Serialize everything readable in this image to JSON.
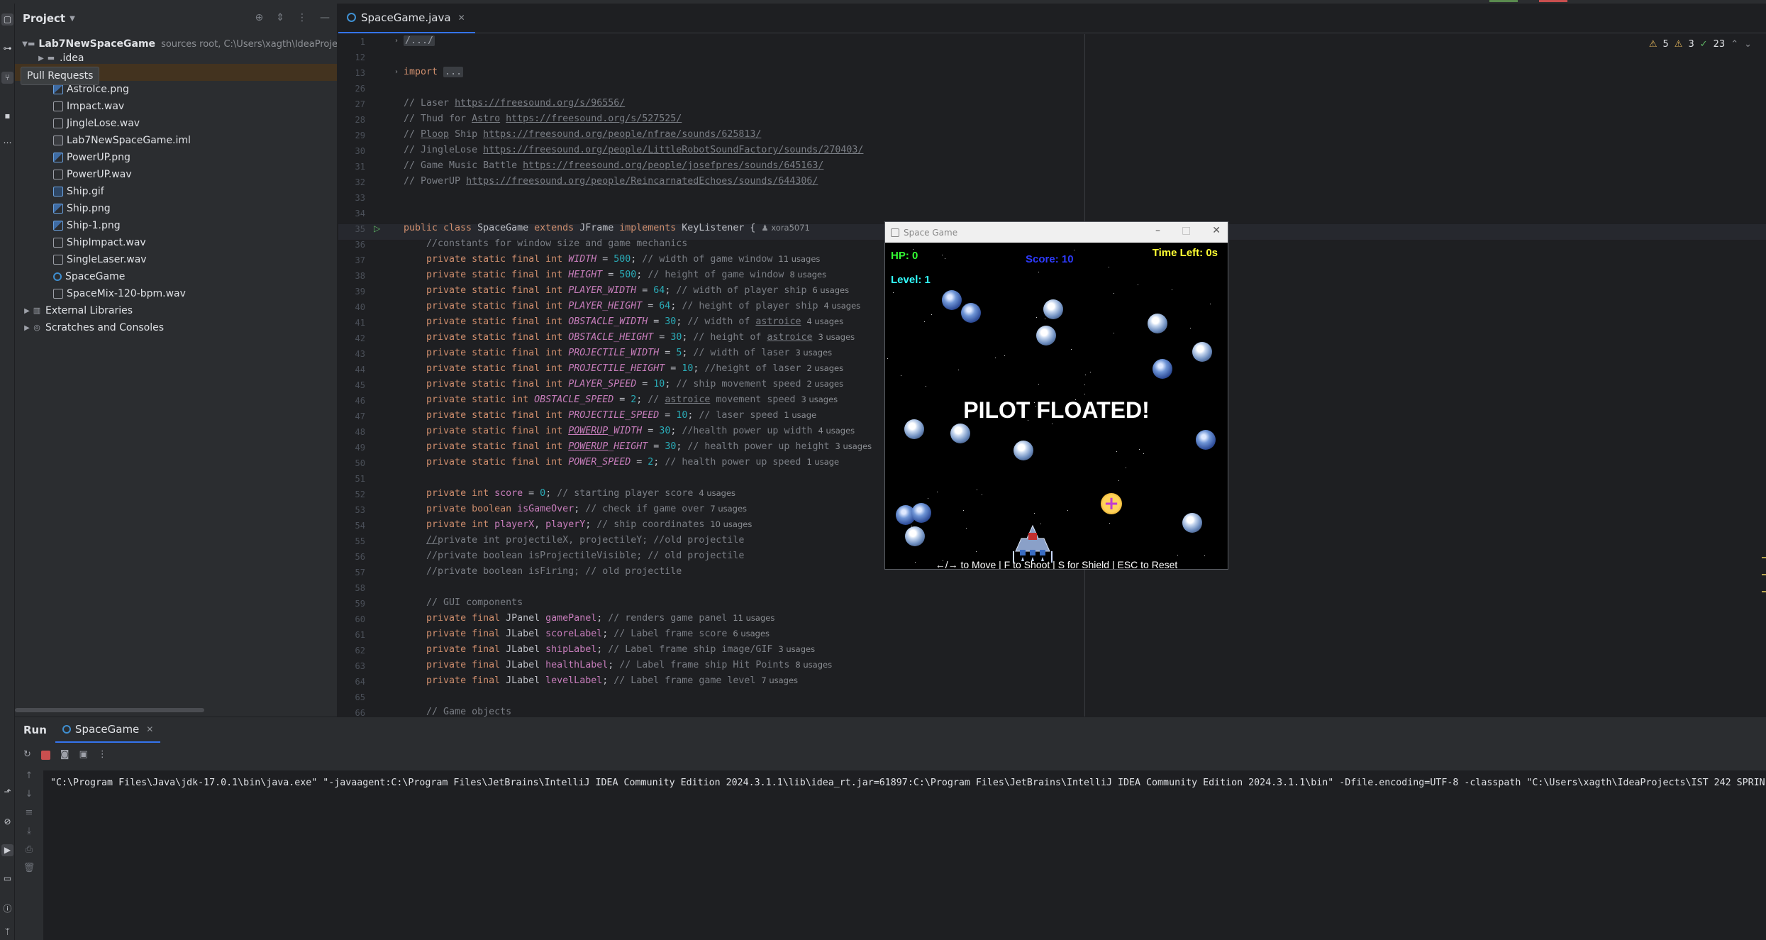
{
  "tooltip": "Pull Requests",
  "project_panel": {
    "title": "Project",
    "root": {
      "name": "Lab7NewSpaceGame",
      "hint": "sources root,  C:\\Users\\xagth\\IdeaProje"
    },
    "items": [
      {
        "name": ".idea",
        "type": "folder"
      },
      {
        "name": "",
        "type": "selected"
      },
      {
        "name": "AstroIce.png",
        "type": "img"
      },
      {
        "name": "Impact.wav",
        "type": "wav"
      },
      {
        "name": "JingleLose.wav",
        "type": "wav"
      },
      {
        "name": "Lab7NewSpaceGame.iml",
        "type": "iml"
      },
      {
        "name": "PowerUP.png",
        "type": "img"
      },
      {
        "name": "PowerUP.wav",
        "type": "wav"
      },
      {
        "name": "Ship.gif",
        "type": "gif"
      },
      {
        "name": "Ship.png",
        "type": "img"
      },
      {
        "name": "Ship-1.png",
        "type": "img"
      },
      {
        "name": "ShipImpact.wav",
        "type": "wav"
      },
      {
        "name": "SingleLaser.wav",
        "type": "wav"
      },
      {
        "name": "SpaceGame",
        "type": "cls"
      },
      {
        "name": "SpaceMix-120-bpm.wav",
        "type": "wav"
      }
    ],
    "external_libraries": "External Libraries",
    "scratches": "Scratches and Consoles"
  },
  "editor": {
    "tab": "SpaceGame.java",
    "inspections": {
      "warnings": "5",
      "weak": "3",
      "checks": "23"
    },
    "author_hint": "xora5071"
  },
  "game": {
    "title": "Space Game",
    "hp": "HP: 0",
    "score": "Score: 10",
    "time_left": "Time Left: 0s",
    "level": "Level: 1",
    "message": "PILOT FLOATED!",
    "controls": "←/→ to Move | F to Shoot | S for Shield | ESC to Reset",
    "colors": {
      "hp": "#33ff33",
      "score": "#2e3bff",
      "time": "#ffff33",
      "level": "#33ffff"
    }
  },
  "run_panel": {
    "title": "Run",
    "tab": "SpaceGame",
    "console": "\"C:\\Program Files\\Java\\jdk-17.0.1\\bin\\java.exe\" \"-javaagent:C:\\Program Files\\JetBrains\\IntelliJ IDEA Community Edition 2024.3.1.1\\lib\\idea_rt.jar=61897:C:\\Program Files\\JetBrains\\IntelliJ IDEA Community Edition 2024.3.1.1\\bin\" -Dfile.encoding=UTF-8 -classpath \"C:\\Users\\xagth\\IdeaProjects\\IST 242 SPRIN"
  },
  "code": [
    {
      "n": "1",
      "html": "<span class=\"fold\">/.../</span>"
    },
    {
      "n": "12",
      "html": ""
    },
    {
      "n": "13",
      "html": "<span class=\"kw\">import</span> <span class=\"fold\">...</span>"
    },
    {
      "n": "26",
      "html": ""
    },
    {
      "n": "27",
      "html": "<span class=\"cm\">// Laser <span class=\"lnk\">https://freesound.org/s/96556/</span></span>"
    },
    {
      "n": "28",
      "html": "<span class=\"cm\">// Thud for <u>Astro</u> <span class=\"lnk\">https://freesound.org/s/527525/</span></span>"
    },
    {
      "n": "29",
      "html": "<span class=\"cm\">// <u>Ploop</u> Ship <span class=\"lnk\">https://freesound.org/people/nfrae/sounds/625813/</span></span>"
    },
    {
      "n": "30",
      "html": "<span class=\"cm\">// JingleLose <span class=\"lnk\">https://freesound.org/people/LittleRobotSoundFactory/sounds/270403/</span></span>"
    },
    {
      "n": "31",
      "html": "<span class=\"cm\">// Game Music Battle <span class=\"lnk\">https://freesound.org/people/josefpres/sounds/645163/</span></span>"
    },
    {
      "n": "32",
      "html": "<span class=\"cm\">// PowerUP <span class=\"lnk\">https://freesound.org/people/ReincarnatedEchoes/sounds/644306/</span></span>"
    },
    {
      "n": "33",
      "html": ""
    },
    {
      "n": "34",
      "html": ""
    },
    {
      "n": "35",
      "html": "<span class=\"kw\">public class</span> SpaceGame <span class=\"kw\">extends</span> JFrame <span class=\"kw\">implements</span> KeyListener {<span class=\"usage\">&#9823; xora5071</span>"
    },
    {
      "n": "36",
      "html": "    <span class=\"cm\">//constants for window size and game mechanics</span>"
    },
    {
      "n": "37",
      "html": "    <span class=\"kw\">private static final int</span> <span class=\"fld\">WIDTH</span> = <span class=\"num\">500</span>; <span class=\"cm\">// width of game window</span><span class=\"usage\">11 usages</span>"
    },
    {
      "n": "38",
      "html": "    <span class=\"kw\">private static final int</span> <span class=\"fld\">HEIGHT</span> = <span class=\"num\">500</span>; <span class=\"cm\">// height of game window</span><span class=\"usage\">8 usages</span>"
    },
    {
      "n": "39",
      "html": "    <span class=\"kw\">private static final int</span> <span class=\"fld\">PLAYER_WIDTH</span> = <span class=\"num\">64</span>; <span class=\"cm\">// width of player ship</span><span class=\"usage\">6 usages</span>"
    },
    {
      "n": "40",
      "html": "    <span class=\"kw\">private static final int</span> <span class=\"fld\">PLAYER_HEIGHT</span> = <span class=\"num\">64</span>; <span class=\"cm\">// height of player ship</span><span class=\"usage\">4 usages</span>"
    },
    {
      "n": "41",
      "html": "    <span class=\"kw\">private static final int</span> <span class=\"fld\">OBSTACLE_WIDTH</span> = <span class=\"num\">30</span>; <span class=\"cm\">// width of <u>astroice</u></span><span class=\"usage\">4 usages</span>"
    },
    {
      "n": "42",
      "html": "    <span class=\"kw\">private static final int</span> <span class=\"fld\">OBSTACLE_HEIGHT</span> = <span class=\"num\">30</span>; <span class=\"cm\">// height of <u>astroice</u></span><span class=\"usage\">3 usages</span>"
    },
    {
      "n": "43",
      "html": "    <span class=\"kw\">private static final int</span> <span class=\"fld\">PROJECTILE_WIDTH</span> = <span class=\"num\">5</span>; <span class=\"cm\">// width of laser</span><span class=\"usage\">3 usages</span>"
    },
    {
      "n": "44",
      "html": "    <span class=\"kw\">private static final int</span> <span class=\"fld\">PROJECTILE_HEIGHT</span> = <span class=\"num\">10</span>; <span class=\"cm\">//height of laser</span><span class=\"usage\">2 usages</span>"
    },
    {
      "n": "45",
      "html": "    <span class=\"kw\">private static final int</span> <span class=\"fld\">PLAYER_SPEED</span> = <span class=\"num\">10</span>; <span class=\"cm\">// ship movement speed</span><span class=\"usage\">2 usages</span>"
    },
    {
      "n": "46",
      "html": "    <span class=\"kw\">private static int</span> <span class=\"fld\">OBSTACLE_SPEED</span> = <span class=\"num\">2</span>; <span class=\"cm\">// <u>astroice</u> movement speed</span><span class=\"usage\">3 usages</span>"
    },
    {
      "n": "47",
      "html": "    <span class=\"kw\">private static final int</span> <span class=\"fld\">PROJECTILE_SPEED</span> = <span class=\"num\">10</span>; <span class=\"cm\">// laser speed</span><span class=\"usage\">1 usage</span>"
    },
    {
      "n": "48",
      "html": "    <span class=\"kw\">private static final int</span> <span class=\"fld\"><u>POWERUP</u>_WIDTH</span> = <span class=\"num\">30</span>; <span class=\"cm\">//health power up width</span><span class=\"usage\">4 usages</span>"
    },
    {
      "n": "49",
      "html": "    <span class=\"kw\">private static final int</span> <span class=\"fld\"><u>POWERUP</u>_HEIGHT</span> = <span class=\"num\">30</span>; <span class=\"cm\">// health power up height</span><span class=\"usage\">3 usages</span>"
    },
    {
      "n": "50",
      "html": "    <span class=\"kw\">private static final int</span> <span class=\"fld\">POWER_SPEED</span> = <span class=\"num\">2</span>; <span class=\"cm\">// health power up speed</span><span class=\"usage\">1 usage</span>"
    },
    {
      "n": "51",
      "html": ""
    },
    {
      "n": "52",
      "html": "    <span class=\"kw\">private int</span> <span class=\"fld2\">score</span> = <span class=\"num\">0</span>; <span class=\"cm\">// starting player score</span><span class=\"usage\">4 usages</span>"
    },
    {
      "n": "53",
      "html": "    <span class=\"kw\">private boolean</span> <span class=\"fld2\">isGameOver</span>; <span class=\"cm\">// check if game over</span><span class=\"usage\">7 usages</span>"
    },
    {
      "n": "54",
      "html": "    <span class=\"kw\">private int</span> <span class=\"fld2\">playerX</span>, <span class=\"fld2\">playerY</span>; <span class=\"cm\">// ship coordinates</span><span class=\"usage\">10 usages</span>"
    },
    {
      "n": "55",
      "html": "    <span class=\"cm\"><u>//</u>private int projectileX, projectileY; //old projectile</span>"
    },
    {
      "n": "56",
      "html": "    <span class=\"cm\">//private boolean isProjectileVisible; // old projectile</span>"
    },
    {
      "n": "57",
      "html": "    <span class=\"cm\">//private boolean isFiring; // old projectile</span>"
    },
    {
      "n": "58",
      "html": ""
    },
    {
      "n": "59",
      "html": "    <span class=\"cm\">// GUI components</span>"
    },
    {
      "n": "60",
      "html": "    <span class=\"kw\">private final</span> JPanel <span class=\"fld2\">gamePanel</span>; <span class=\"cm\">// renders game panel</span><span class=\"usage\">11 usages</span>"
    },
    {
      "n": "61",
      "html": "    <span class=\"kw\">private final</span> JLabel <span class=\"fld2\">scoreLabel</span>; <span class=\"cm\">// Label frame score</span><span class=\"usage\">6 usages</span>"
    },
    {
      "n": "62",
      "html": "    <span class=\"kw\">private final</span> JLabel <span class=\"fld2\">shipLabel</span>; <span class=\"cm\">// Label frame ship image/GIF</span><span class=\"usage\">3 usages</span>"
    },
    {
      "n": "63",
      "html": "    <span class=\"kw\">private final</span> JLabel <span class=\"fld2\">healthLabel</span>; <span class=\"cm\">// Label frame ship Hit Points</span><span class=\"usage\">8 usages</span>"
    },
    {
      "n": "64",
      "html": "    <span class=\"kw\">private final</span> JLabel <span class=\"fld2\">levelLabel</span>; <span class=\"cm\">// Label frame game level</span><span class=\"usage\">7 usages</span>"
    },
    {
      "n": "65",
      "html": ""
    },
    {
      "n": "66",
      "html": "    <span class=\"cm\">// Game objects</span>"
    }
  ]
}
